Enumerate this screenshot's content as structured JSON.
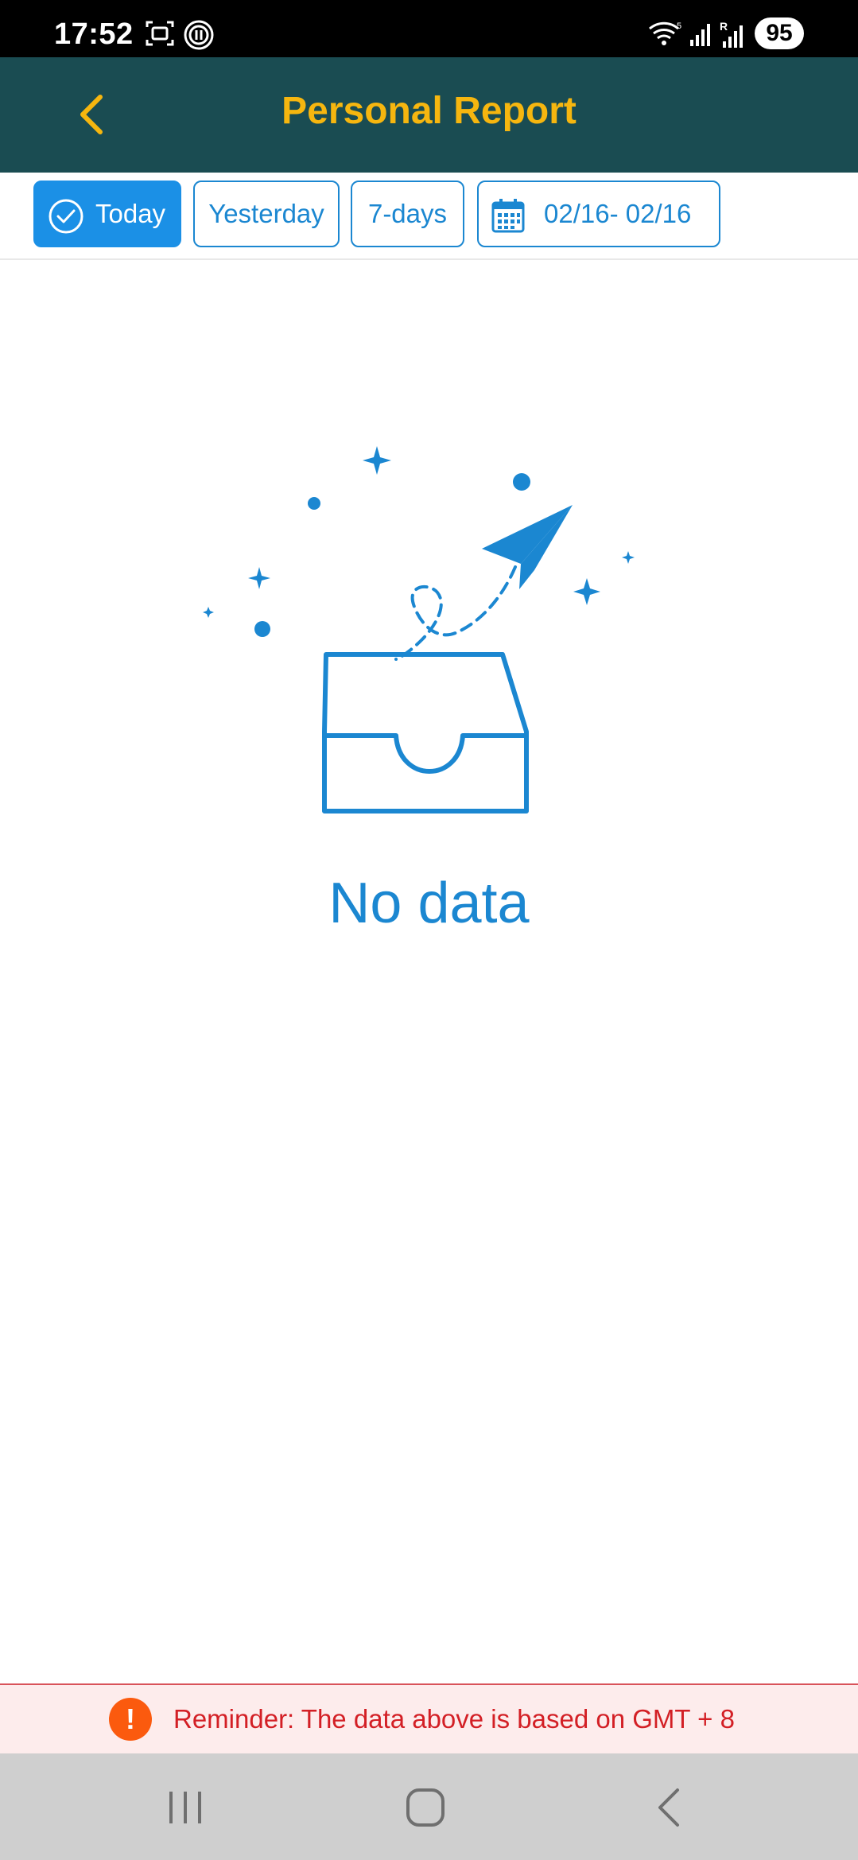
{
  "status_bar": {
    "time": "17:52",
    "battery": "95",
    "icons": [
      "screenshot-icon",
      "sync-icon",
      "wifi-icon",
      "signal-icon",
      "signal-roaming-icon"
    ]
  },
  "header": {
    "title": "Personal Report",
    "back_icon": "chevron-left-icon"
  },
  "filters": {
    "today": "Today",
    "yesterday": "Yesterday",
    "seven_days": "7-days",
    "date_range": "02/16- 02/16",
    "active": "today"
  },
  "empty_state": {
    "message": "No data",
    "illustration": "empty-inbox-paper-plane"
  },
  "reminder": {
    "icon": "!",
    "text": "Reminder: The data above is based on GMT + 8"
  },
  "nav": {
    "buttons": [
      "recent-apps-icon",
      "home-icon",
      "back-icon"
    ]
  },
  "colors": {
    "header_bg": "#1a4c52",
    "title": "#f6b60f",
    "accent": "#1b87d1",
    "reminder_bg": "#fdecec",
    "reminder_text": "#d31f25",
    "reminder_icon": "#fb5a0e"
  }
}
